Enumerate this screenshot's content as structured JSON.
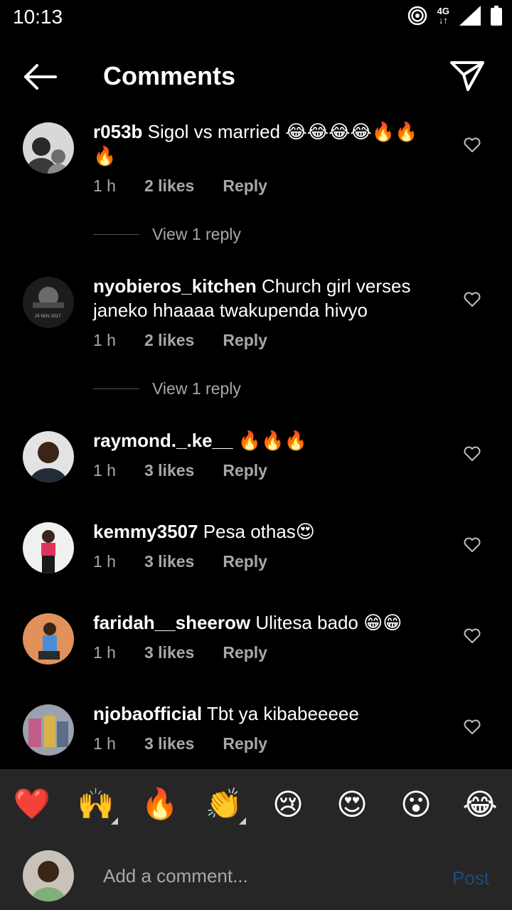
{
  "status": {
    "time": "10:13",
    "network": "4G"
  },
  "header": {
    "title": "Comments"
  },
  "comments": [
    {
      "username": "r053b",
      "text": "Sigol vs married 😂😂😂😂🔥🔥🔥",
      "time": "1 h",
      "likes": "2 likes",
      "reply": "Reply",
      "view_replies": "View 1 reply"
    },
    {
      "username": "nyobieros_kitchen",
      "text": "Church girl verses janeko hhaaaa twakupenda hivyo",
      "time": "1 h",
      "likes": "2 likes",
      "reply": "Reply",
      "view_replies": "View 1 reply",
      "avatar_text": "25 NOV 2017"
    },
    {
      "username": "raymond._.ke__",
      "text": "🔥🔥🔥",
      "time": "1 h",
      "likes": "3 likes",
      "reply": "Reply"
    },
    {
      "username": "kemmy3507",
      "text": "Pesa othas😍",
      "time": "1 h",
      "likes": "3 likes",
      "reply": "Reply"
    },
    {
      "username": "faridah__sheerow",
      "text": "Ulitesa bado 😁😁",
      "time": "1 h",
      "likes": "3 likes",
      "reply": "Reply"
    },
    {
      "username": "njobaofficial",
      "text": "Tbt ya kibabeeeee",
      "time": "1 h",
      "likes": "3 likes",
      "reply": "Reply"
    }
  ],
  "emoji_bar": [
    "❤️",
    "🙌",
    "🔥",
    "👏",
    "😢",
    "😍",
    "😮",
    "😂"
  ],
  "composer": {
    "placeholder": "Add a comment...",
    "post_label": "Post"
  },
  "colors": {
    "background": "#000000",
    "panel": "#262626",
    "muted": "#a8a8a8",
    "post_disabled": "#1b4d7a"
  }
}
